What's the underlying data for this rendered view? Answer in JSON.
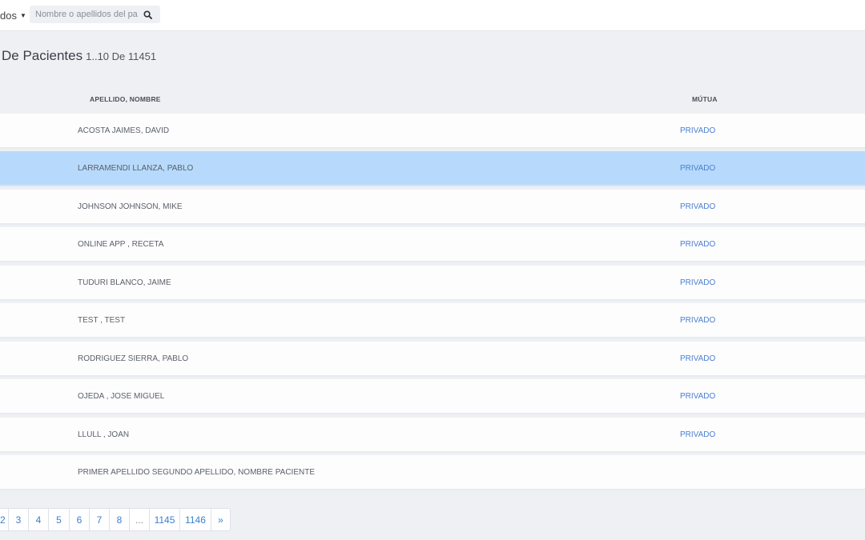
{
  "header": {
    "filter_label": "dos",
    "search_placeholder": "Nombre o apellidos del pa"
  },
  "title": {
    "main": "De Pacientes",
    "count": "1..10 De 11451"
  },
  "table": {
    "columns": {
      "name": "APELLIDO, NOMBRE",
      "mutua": "MÚTUA"
    },
    "rows": [
      {
        "name": "ACOSTA JAIMES, DAVID",
        "mutua": "PRIVADO"
      },
      {
        "name": "LARRAMENDI LLANZA, PABLO",
        "mutua": "PRIVADO",
        "selected": true
      },
      {
        "name": "JOHNSON JOHNSON, MIKE",
        "mutua": "PRIVADO"
      },
      {
        "name": "ONLINE APP , RECETA",
        "mutua": "PRIVADO"
      },
      {
        "name": "TUDURI BLANCO, JAIME",
        "mutua": "PRIVADO"
      },
      {
        "name": "TEST , TEST",
        "mutua": "PRIVADO"
      },
      {
        "name": "RODRIGUEZ SIERRA, PABLO",
        "mutua": "PRIVADO"
      },
      {
        "name": "OJEDA , JOSE MIGUEL",
        "mutua": "PRIVADO"
      },
      {
        "name": "LLULL , JOAN",
        "mutua": "PRIVADO"
      },
      {
        "name": "PRIMER APELLIDO SEGUNDO APELLIDO, NOMBRE PACIENTE",
        "mutua": ""
      }
    ]
  },
  "pagination": {
    "pages": [
      "2",
      "3",
      "4",
      "5",
      "6",
      "7",
      "8",
      "...",
      "1145",
      "1146",
      "»"
    ]
  },
  "colors": {
    "selected_row": "#b7dafc",
    "link": "#4a7fd0",
    "background": "#eef0f4"
  }
}
